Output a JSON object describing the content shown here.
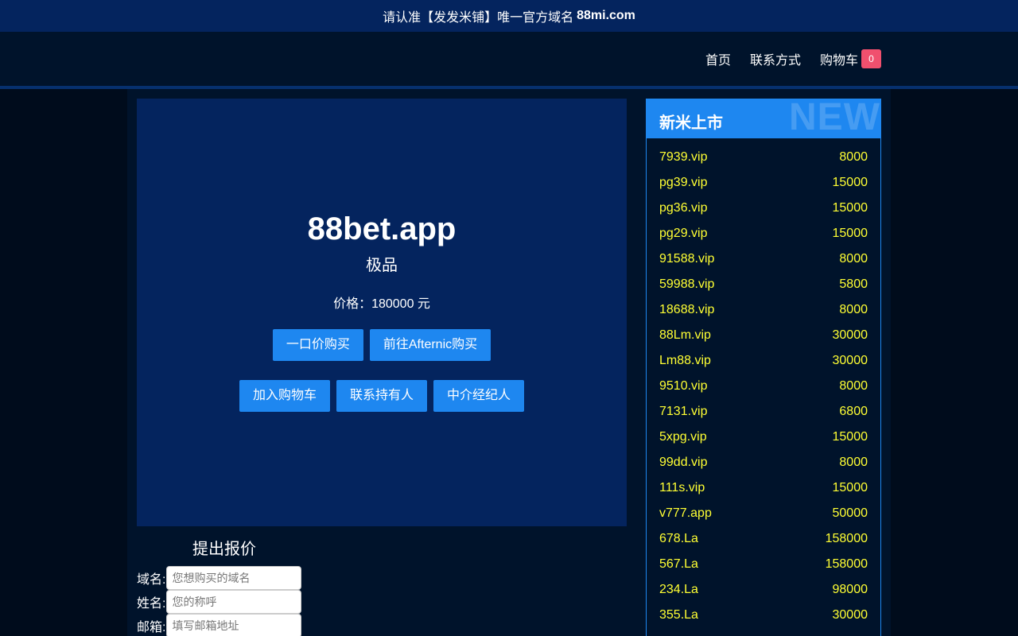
{
  "notice": {
    "text": "请认准【发发米铺】唯一官方域名",
    "domain": "88mi.com"
  },
  "nav": {
    "home": "首页",
    "contact": "联系方式",
    "cart": "购物车",
    "cart_count": "0"
  },
  "hero": {
    "domain": "88bet.app",
    "tag": "极品",
    "price": "价格：180000 元",
    "buttons": {
      "buy_now": "一口价购买",
      "afternic": "前往Afternic购买",
      "add_cart": "加入购物车",
      "contact_owner": "联系持有人",
      "broker": "中介经纪人"
    }
  },
  "offer": {
    "title": "提出报价",
    "domain_label": "域名:",
    "domain_placeholder": "您想购买的域名",
    "name_label": "姓名:",
    "name_placeholder": "您的称呼",
    "email_label": "邮箱:",
    "email_placeholder": "填写邮箱地址"
  },
  "sidebar": {
    "title": "新米上市",
    "watermark": "NEW",
    "items": [
      {
        "name": "7939.vip",
        "price": "8000"
      },
      {
        "name": "pg39.vip",
        "price": "15000"
      },
      {
        "name": "pg36.vip",
        "price": "15000"
      },
      {
        "name": "pg29.vip",
        "price": "15000"
      },
      {
        "name": "91588.vip",
        "price": "8000"
      },
      {
        "name": "59988.vip",
        "price": "5800"
      },
      {
        "name": "18688.vip",
        "price": "8000"
      },
      {
        "name": "88Lm.vip",
        "price": "30000"
      },
      {
        "name": "Lm88.vip",
        "price": "30000"
      },
      {
        "name": "9510.vip",
        "price": "8000"
      },
      {
        "name": "7131.vip",
        "price": "6800"
      },
      {
        "name": "5xpg.vip",
        "price": "15000"
      },
      {
        "name": "99dd.vip",
        "price": "8000"
      },
      {
        "name": "111s.vip",
        "price": "15000"
      },
      {
        "name": "v777.app",
        "price": "50000"
      },
      {
        "name": "678.La",
        "price": "158000"
      },
      {
        "name": "567.La",
        "price": "158000"
      },
      {
        "name": "234.La",
        "price": "98000"
      },
      {
        "name": "355.La",
        "price": "30000"
      }
    ]
  },
  "colors": {
    "accent": "#1e87f0",
    "hero_bg": "#04245e",
    "page_bg": "#00132b",
    "list_text": "#ffff33",
    "badge": "#f0506e"
  }
}
